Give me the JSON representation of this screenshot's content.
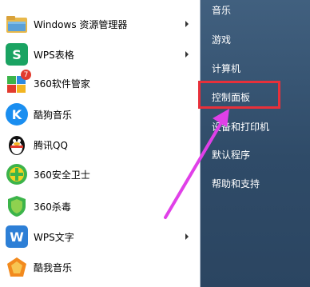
{
  "programs": [
    {
      "label": "Windows 资源管理器",
      "icon": "folder-icon",
      "has_submenu": true
    },
    {
      "label": "WPS表格",
      "icon": "wps-spreadsheet-icon",
      "has_submenu": true
    },
    {
      "label": "360软件管家",
      "icon": "360-software-manager-icon",
      "has_submenu": false
    },
    {
      "label": "酷狗音乐",
      "icon": "kugou-music-icon",
      "has_submenu": false
    },
    {
      "label": "腾讯QQ",
      "icon": "qq-penguin-icon",
      "has_submenu": false
    },
    {
      "label": "360安全卫士",
      "icon": "360-security-icon",
      "has_submenu": false
    },
    {
      "label": "360杀毒",
      "icon": "360-antivirus-icon",
      "has_submenu": false
    },
    {
      "label": "WPS文字",
      "icon": "wps-writer-icon",
      "has_submenu": true
    },
    {
      "label": "酷我音乐",
      "icon": "kuwo-music-icon",
      "has_submenu": false
    }
  ],
  "icon_badges": {
    "software_manager_badge": "7"
  },
  "icon_letters": {
    "wps_spreadsheet": "S",
    "kugou": "K",
    "wps_writer": "W",
    "antivirus": "+"
  },
  "right_menu": {
    "items": [
      {
        "label": "音乐"
      },
      {
        "label": "游戏"
      },
      {
        "label": "计算机"
      },
      {
        "label": "控制面板",
        "highlighted": true
      },
      {
        "label": "设备和打印机"
      },
      {
        "label": "默认程序"
      },
      {
        "label": "帮助和支持"
      }
    ]
  },
  "colors": {
    "highlight_border": "#e8303a",
    "annotation_arrow": "#e040e8",
    "right_pane": "#3a5776"
  }
}
